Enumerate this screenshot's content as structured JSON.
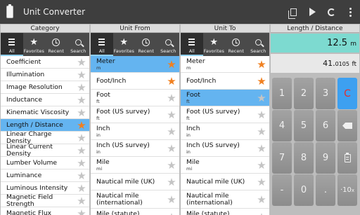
{
  "app": {
    "title": "Unit Converter"
  },
  "columns": {
    "category": "Category",
    "from": "Unit From",
    "to": "Unit To",
    "result": "Length / Distance"
  },
  "tabs": [
    "All",
    "Favorites",
    "Recent",
    "Search"
  ],
  "categories": [
    {
      "name": "Coefficient",
      "fav": false,
      "selected": false
    },
    {
      "name": "Illumination",
      "fav": false,
      "selected": false
    },
    {
      "name": "Image Resolution",
      "fav": false,
      "selected": false
    },
    {
      "name": "Inductance",
      "fav": false,
      "selected": false
    },
    {
      "name": "Kinematic Viscosity",
      "fav": false,
      "selected": false
    },
    {
      "name": "Length / Distance",
      "fav": true,
      "selected": true
    },
    {
      "name": "Linear Charge Density",
      "fav": false,
      "selected": false
    },
    {
      "name": "Linear Current Density",
      "fav": false,
      "selected": false
    },
    {
      "name": "Lumber Volume",
      "fav": false,
      "selected": false
    },
    {
      "name": "Luminance",
      "fav": false,
      "selected": false
    },
    {
      "name": "Luminous Intensity",
      "fav": false,
      "selected": false
    },
    {
      "name": "Magnetic Field Strength",
      "fav": false,
      "selected": false
    },
    {
      "name": "Magnetic Flux",
      "fav": false,
      "selected": false
    }
  ],
  "units_from": [
    {
      "name": "Meter",
      "abbr": "m",
      "fav": true,
      "selected": true
    },
    {
      "name": "Foot/Inch",
      "abbr": "",
      "fav": true,
      "selected": false
    },
    {
      "name": "Foot",
      "abbr": "ft",
      "fav": false,
      "selected": false
    },
    {
      "name": "Foot (US survey)",
      "abbr": "ft",
      "fav": false,
      "selected": false
    },
    {
      "name": "Inch",
      "abbr": "in",
      "fav": false,
      "selected": false
    },
    {
      "name": "Inch (US survey)",
      "abbr": "in",
      "fav": false,
      "selected": false
    },
    {
      "name": "Mile",
      "abbr": "mi",
      "fav": false,
      "selected": false
    },
    {
      "name": "Nautical mile (UK)",
      "abbr": "",
      "fav": false,
      "selected": false
    },
    {
      "name": "Nautical mile (international)",
      "abbr": "",
      "fav": false,
      "selected": false
    },
    {
      "name": "Mile (statute)",
      "abbr": "mi",
      "fav": false,
      "selected": false
    }
  ],
  "units_to": [
    {
      "name": "Meter",
      "abbr": "m",
      "fav": true,
      "selected": false
    },
    {
      "name": "Foot/Inch",
      "abbr": "",
      "fav": true,
      "selected": false
    },
    {
      "name": "Foot",
      "abbr": "ft",
      "fav": false,
      "selected": true
    },
    {
      "name": "Foot (US survey)",
      "abbr": "ft",
      "fav": false,
      "selected": false
    },
    {
      "name": "Inch",
      "abbr": "in",
      "fav": false,
      "selected": false
    },
    {
      "name": "Inch (US survey)",
      "abbr": "in",
      "fav": false,
      "selected": false
    },
    {
      "name": "Mile",
      "abbr": "mi",
      "fav": false,
      "selected": false
    },
    {
      "name": "Nautical mile (UK)",
      "abbr": "",
      "fav": false,
      "selected": false
    },
    {
      "name": "Nautical mile (international)",
      "abbr": "",
      "fav": false,
      "selected": false
    },
    {
      "name": "Mile (statute)",
      "abbr": "mi",
      "fav": false,
      "selected": false
    }
  ],
  "display": {
    "from_value": "12.5",
    "from_unit": "m",
    "to_value_main": "41.",
    "to_value_small": "0105",
    "to_unit": "ft"
  },
  "keypad": {
    "k1": "1",
    "k2": "2",
    "k3": "3",
    "clear": "C",
    "k4": "4",
    "k5": "5",
    "k6": "6",
    "k7": "7",
    "k8": "8",
    "k9": "9",
    "minus": "-",
    "k0": "0",
    "dot": ".",
    "exp_base": "·10",
    "exp_sup": "x"
  },
  "colors": {
    "selection": "#64b4f0",
    "favorite": "#f08020",
    "from_display": "#7ddad0",
    "clear_key": "#3da0f0"
  }
}
